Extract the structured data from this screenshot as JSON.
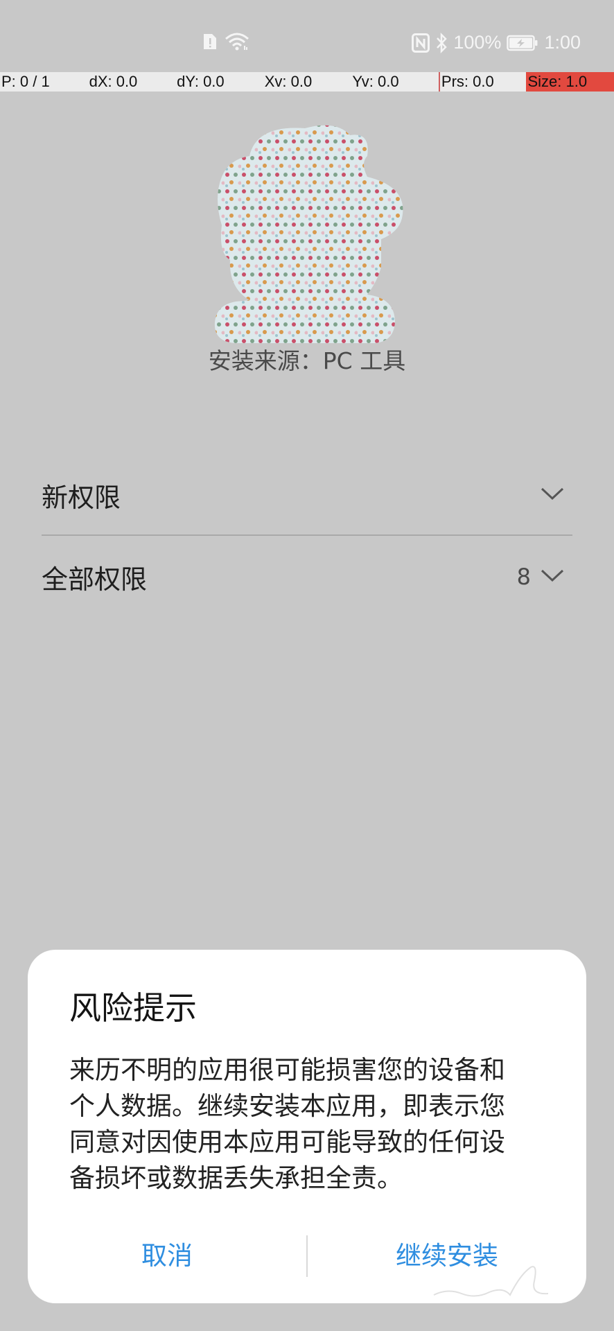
{
  "status_bar": {
    "icons_center": [
      "sim-alert-icon",
      "wifi-icon"
    ],
    "icons_right": [
      "nfc-icon",
      "bluetooth-icon"
    ],
    "battery_percent": "100%",
    "battery_icon": "battery-charging-icon",
    "time": "1:00"
  },
  "pointer_location": {
    "p": "P: 0 / 1",
    "dx": "dX: 0.0",
    "dy": "dY: 0.0",
    "xv": "Xv: 0.0",
    "yv": "Yv: 0.0",
    "prs": "Prs: 0.0",
    "size": "Size: 1.0",
    "size_highlight_color": "#e2493f"
  },
  "app": {
    "icon": "app-icon-polka-dot",
    "install_source": "安装来源：PC 工具"
  },
  "permissions": {
    "new": {
      "label": "新权限"
    },
    "all": {
      "label": "全部权限",
      "count": "8"
    }
  },
  "dialog": {
    "title": "风险提示",
    "body_lines": [
      "来历不明的应用很可能损害您的设备和",
      "个人数据。继续安装本应用，即表示您",
      "同意对因使用本应用可能导致的任何设",
      "备损坏或数据丢失承担全责。"
    ],
    "cancel_label": "取消",
    "continue_label": "继续安装",
    "button_color": "#2f8ee0"
  },
  "colors": {
    "background": "#c8c8c8",
    "dialog_background": "#ffffff"
  }
}
